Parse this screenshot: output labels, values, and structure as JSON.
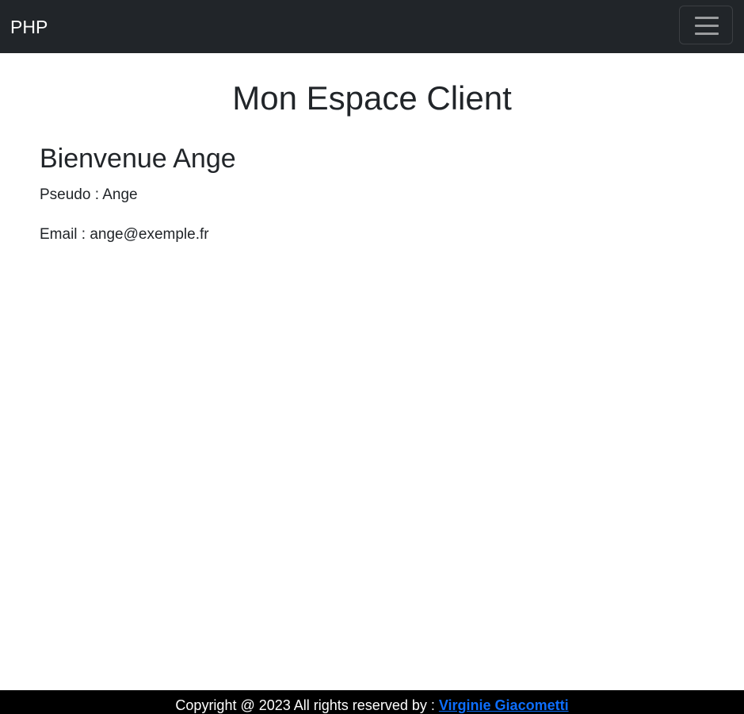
{
  "navbar": {
    "brand": "PHP",
    "toggler_icon": "hamburger-menu-icon"
  },
  "main": {
    "title": "Mon Espace Client",
    "welcome": "Bienvenue Ange",
    "pseudo": "Pseudo : Ange",
    "email": "Email : ange@exemple.fr"
  },
  "footer": {
    "copyright": "Copyright @ 2023 All rights reserved by : ",
    "author": "Virginie Giacometti"
  },
  "colors": {
    "navbar_bg": "#212529",
    "footer_bg": "#000000",
    "link": "#0d6efd",
    "text": "#212529"
  }
}
